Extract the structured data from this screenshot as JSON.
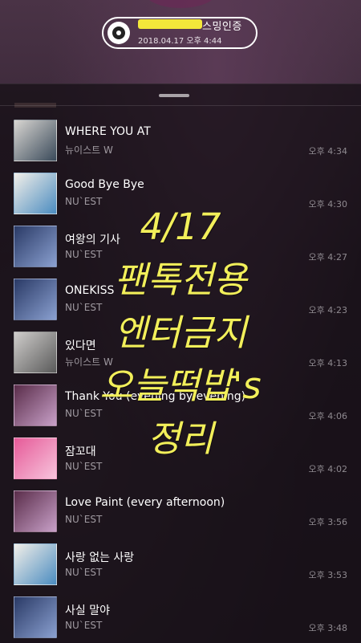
{
  "header": {
    "badge_title": "스밍인증",
    "badge_date": "2018.04.17 오후 4:44"
  },
  "songs": [
    {
      "title": "WHERE YOU AT",
      "artist": "뉴이스트 W",
      "time": "오후 4:34",
      "art_colors": [
        "#d9d6d2",
        "#3a4a5a"
      ]
    },
    {
      "title": "Good Bye Bye",
      "artist": "NU`EST",
      "time": "오후 4:30",
      "art_colors": [
        "#f2efe9",
        "#4b8cc0"
      ]
    },
    {
      "title": "여왕의 기사",
      "artist": "NU`EST",
      "time": "오후 4:27",
      "art_colors": [
        "#2a3a66",
        "#8aa0d0"
      ]
    },
    {
      "title": "ONEKISS",
      "artist": "NU`EST",
      "time": "오후 4:23",
      "art_colors": [
        "#2a3a66",
        "#8aa0d0"
      ]
    },
    {
      "title": "있다면",
      "artist": "뉴이스트 W",
      "time": "오후 4:13",
      "art_colors": [
        "#cfcdcb",
        "#5a5a5a"
      ]
    },
    {
      "title": "Thank You (evening by evening)",
      "artist": "NU`EST",
      "time": "오후 4:06",
      "art_colors": [
        "#5a2d4a",
        "#c8a0c8"
      ]
    },
    {
      "title": "잠꼬대",
      "artist": "NU`EST",
      "time": "오후 4:02",
      "art_colors": [
        "#e65a98",
        "#f7c4dc"
      ]
    },
    {
      "title": "Love Paint (every afternoon)",
      "artist": "NU`EST",
      "time": "오후 3:56",
      "art_colors": [
        "#5a2d4a",
        "#c8a0c8"
      ]
    },
    {
      "title": "사랑 없는 사랑",
      "artist": "NU`EST",
      "time": "오후 3:53",
      "art_colors": [
        "#f2efe9",
        "#4b8cc0"
      ]
    },
    {
      "title": "사실 말야",
      "artist": "NU`EST",
      "time": "오후 3:48",
      "art_colors": [
        "#2a3a66",
        "#8aa0d0"
      ]
    }
  ],
  "overlay_text": [
    "4/17",
    "팬톡전용",
    "엔터금지",
    "오늘떡밥's",
    "정리"
  ]
}
